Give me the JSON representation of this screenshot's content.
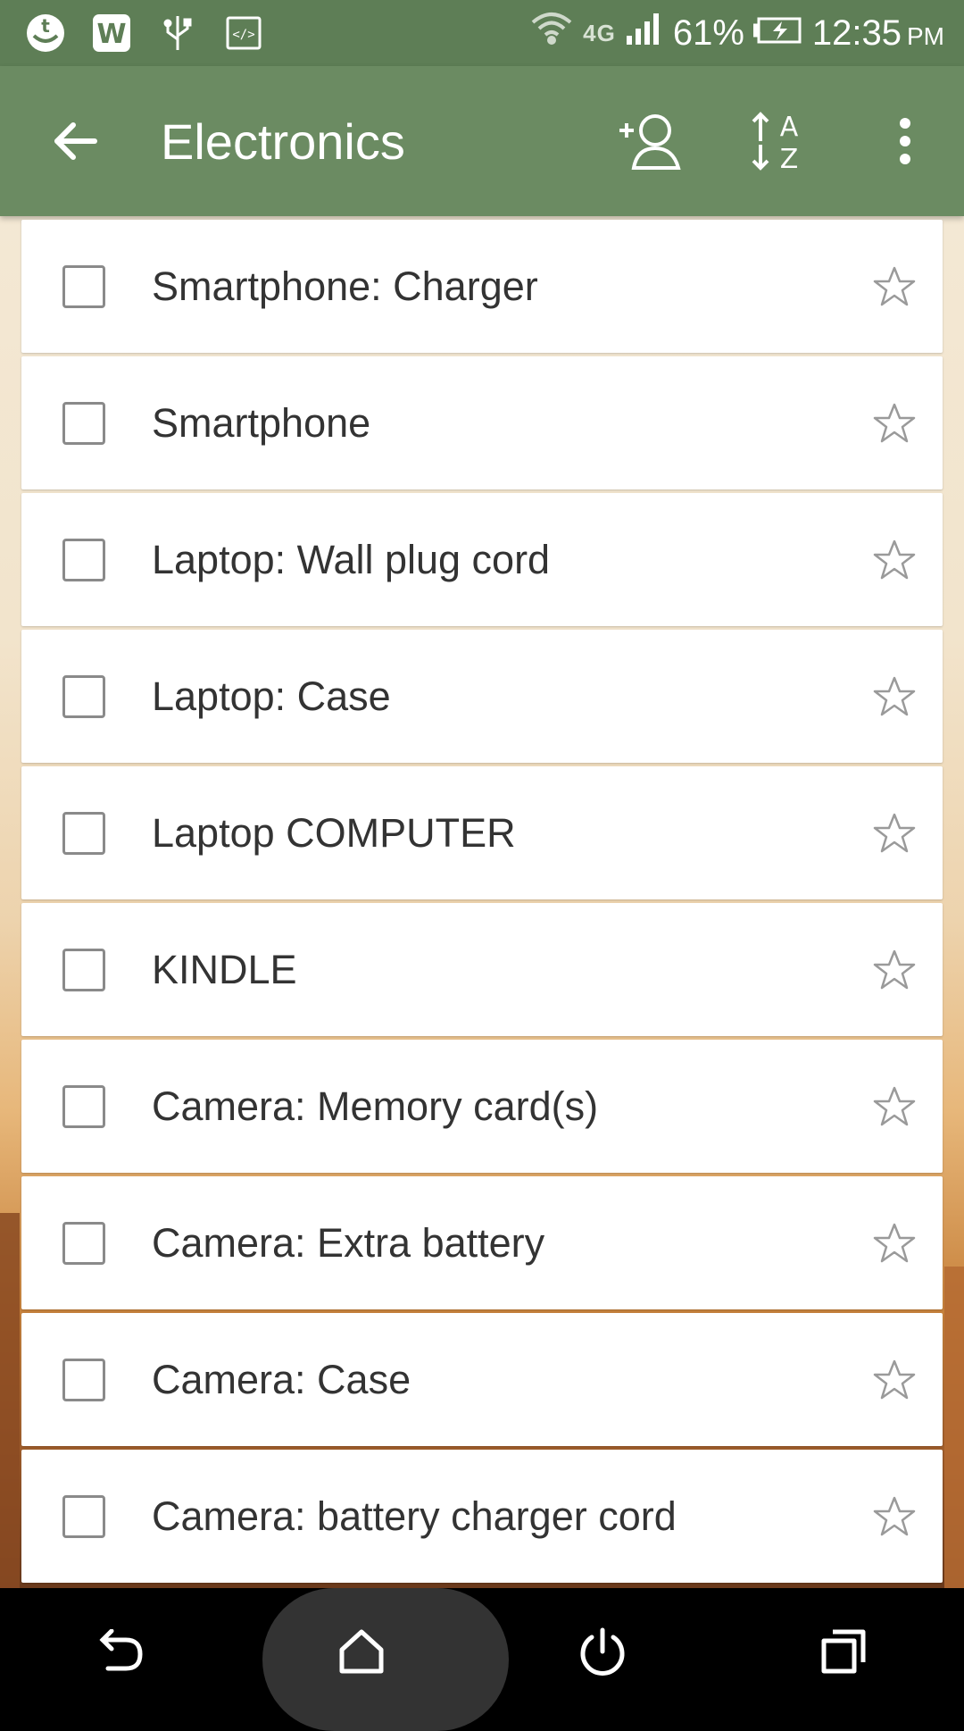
{
  "status_bar": {
    "icons": [
      "tripit-icon",
      "w-app-icon",
      "usb-icon",
      "code-icon"
    ],
    "network": "4G",
    "battery": "61%",
    "time": "12:35",
    "ampm": "PM"
  },
  "app_bar": {
    "title": "Electronics",
    "actions": [
      "add-person-icon",
      "sort-az-icon",
      "more-vert-icon"
    ]
  },
  "items": [
    {
      "label": "Smartphone: Charger",
      "checked": false,
      "starred": false
    },
    {
      "label": "Smartphone",
      "checked": false,
      "starred": false
    },
    {
      "label": "Laptop: Wall plug cord",
      "checked": false,
      "starred": false
    },
    {
      "label": "Laptop: Case",
      "checked": false,
      "starred": false
    },
    {
      "label": "Laptop COMPUTER",
      "checked": false,
      "starred": false
    },
    {
      "label": "KINDLE",
      "checked": false,
      "starred": false
    },
    {
      "label": "Camera: Memory card(s)",
      "checked": false,
      "starred": false
    },
    {
      "label": "Camera: Extra battery",
      "checked": false,
      "starred": false
    },
    {
      "label": "Camera: Case",
      "checked": false,
      "starred": false
    },
    {
      "label": "Camera: battery charger cord",
      "checked": false,
      "starred": false
    }
  ],
  "nav_bar": {
    "buttons": [
      "back-icon",
      "home-icon",
      "power-icon",
      "recents-icon"
    ]
  },
  "colors": {
    "status_bar": "#5e7e56",
    "app_bar": "#6b8b62"
  }
}
